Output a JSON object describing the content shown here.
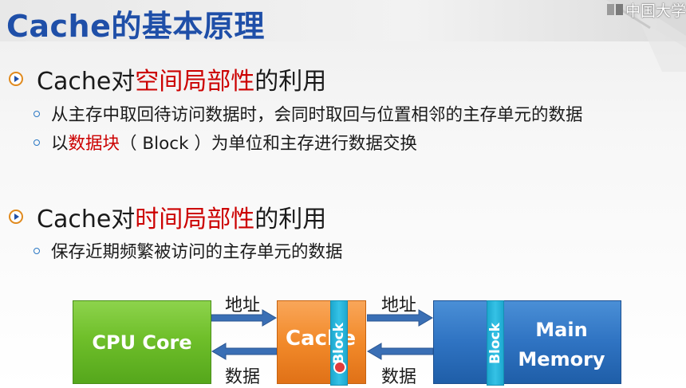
{
  "slide": {
    "title": "Cache的基本原理",
    "logo_text": "中国大学"
  },
  "bullets": [
    {
      "prefix": "Cache对",
      "highlight": "空间局部性",
      "suffix": "的利用",
      "subs": [
        {
          "text": "从主存中取回待访问数据时，会同时取回与位置相邻的主存单元的数据"
        },
        {
          "prefix": "以",
          "highlight": "数据块",
          "suffix": "（ Block ）为单位和主存进行数据交换"
        }
      ]
    },
    {
      "prefix": "Cache对",
      "highlight": "时间局部性",
      "suffix": "的利用",
      "subs": [
        {
          "text": "保存近期频繁被访问的主存单元的数据"
        }
      ]
    }
  ],
  "diagram": {
    "cpu_label": "CPU Core",
    "cache_label": "Cache",
    "main_line1": "Main",
    "main_line2": "Memory",
    "block_label": "Block",
    "addr_label_1": "地址",
    "data_label_1": "数据",
    "addr_label_2": "地址",
    "data_label_2": "数据"
  },
  "colors": {
    "title": "#1f4fa8",
    "highlight": "#cc0000",
    "cpu": "#6fbf2a",
    "cache": "#f28a2a",
    "memory": "#2f73c2",
    "block": "#35c2e6",
    "arrow": "#3a6fb5"
  }
}
